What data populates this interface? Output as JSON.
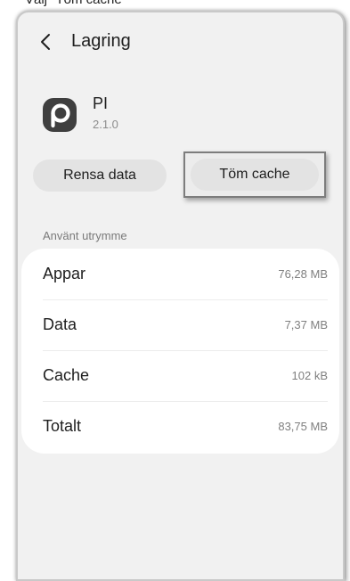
{
  "caption": "Välj \"Töm cache\"",
  "header": {
    "back_icon": "chevron-left-icon",
    "title": "Lagring"
  },
  "app": {
    "icon": "p-logo-icon",
    "name": "PI",
    "version": "2.1.0"
  },
  "actions": {
    "clear_data": "Rensa data",
    "clear_cache": "Töm cache"
  },
  "storage": {
    "section_label": "Använt utrymme",
    "rows": [
      {
        "label": "Appar",
        "value": "76,28 MB"
      },
      {
        "label": "Data",
        "value": "7,37 MB"
      },
      {
        "label": "Cache",
        "value": "102 kB"
      },
      {
        "label": "Totalt",
        "value": "83,75 MB"
      }
    ]
  },
  "colors": {
    "background": "#f1f1f1",
    "card": "#ffffff",
    "button": "#e3e3e3",
    "highlight_border": "#7d7d7d",
    "app_icon": "#3f3f3f"
  }
}
